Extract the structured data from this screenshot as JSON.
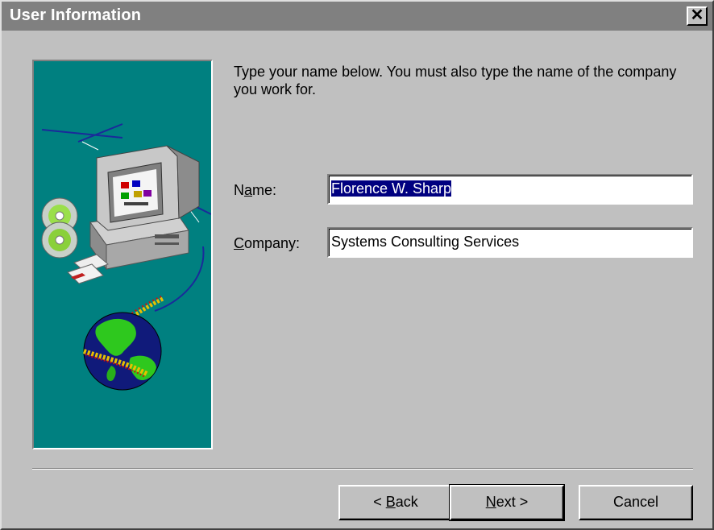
{
  "window": {
    "title": "User Information",
    "close_glyph": "✕"
  },
  "instructions": "Type your name below. You must also type the name of the company you work for.",
  "fields": {
    "name": {
      "label_pre": "N",
      "label_accel": "a",
      "label_post": "me:",
      "value": "Florence W. Sharp",
      "selected": true
    },
    "company": {
      "label_pre": "",
      "label_accel": "C",
      "label_post": "ompany:",
      "value": "Systems Consulting Services"
    }
  },
  "buttons": {
    "back": {
      "pre": "< ",
      "accel": "B",
      "post": "ack"
    },
    "next": {
      "pre": "",
      "accel": "N",
      "post": "ext >"
    },
    "cancel": {
      "label": "Cancel"
    }
  },
  "colors": {
    "dialog_bg": "#c0c0c0",
    "titlebar": "#808080",
    "art_bg": "#008080",
    "selection": "#000080"
  },
  "art_icons": [
    "computer-icon",
    "cd-icon",
    "floppy-disk-icon",
    "globe-icon",
    "network-cable-icon"
  ]
}
